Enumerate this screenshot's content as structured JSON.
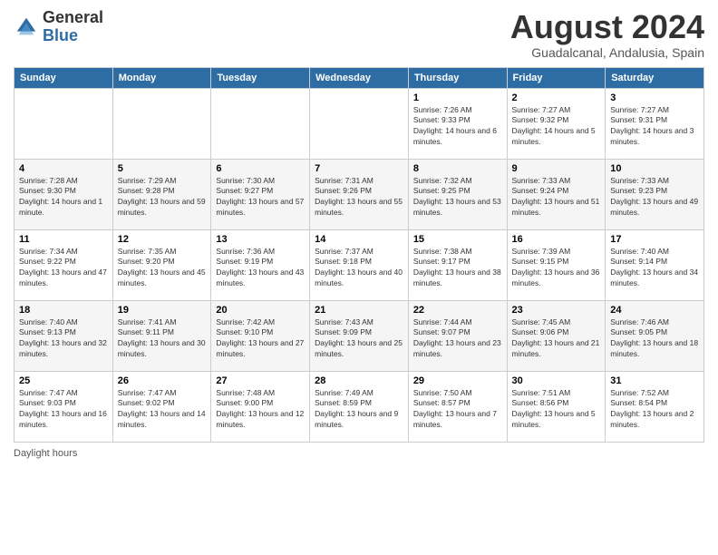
{
  "header": {
    "logo_general": "General",
    "logo_blue": "Blue",
    "main_title": "August 2024",
    "subtitle": "Guadalcanal, Andalusia, Spain"
  },
  "days_of_week": [
    "Sunday",
    "Monday",
    "Tuesday",
    "Wednesday",
    "Thursday",
    "Friday",
    "Saturday"
  ],
  "weeks": [
    [
      {
        "num": "",
        "sunrise": "",
        "sunset": "",
        "daylight": ""
      },
      {
        "num": "",
        "sunrise": "",
        "sunset": "",
        "daylight": ""
      },
      {
        "num": "",
        "sunrise": "",
        "sunset": "",
        "daylight": ""
      },
      {
        "num": "",
        "sunrise": "",
        "sunset": "",
        "daylight": ""
      },
      {
        "num": "1",
        "sunrise": "Sunrise: 7:26 AM",
        "sunset": "Sunset: 9:33 PM",
        "daylight": "Daylight: 14 hours and 6 minutes."
      },
      {
        "num": "2",
        "sunrise": "Sunrise: 7:27 AM",
        "sunset": "Sunset: 9:32 PM",
        "daylight": "Daylight: 14 hours and 5 minutes."
      },
      {
        "num": "3",
        "sunrise": "Sunrise: 7:27 AM",
        "sunset": "Sunset: 9:31 PM",
        "daylight": "Daylight: 14 hours and 3 minutes."
      }
    ],
    [
      {
        "num": "4",
        "sunrise": "Sunrise: 7:28 AM",
        "sunset": "Sunset: 9:30 PM",
        "daylight": "Daylight: 14 hours and 1 minute."
      },
      {
        "num": "5",
        "sunrise": "Sunrise: 7:29 AM",
        "sunset": "Sunset: 9:28 PM",
        "daylight": "Daylight: 13 hours and 59 minutes."
      },
      {
        "num": "6",
        "sunrise": "Sunrise: 7:30 AM",
        "sunset": "Sunset: 9:27 PM",
        "daylight": "Daylight: 13 hours and 57 minutes."
      },
      {
        "num": "7",
        "sunrise": "Sunrise: 7:31 AM",
        "sunset": "Sunset: 9:26 PM",
        "daylight": "Daylight: 13 hours and 55 minutes."
      },
      {
        "num": "8",
        "sunrise": "Sunrise: 7:32 AM",
        "sunset": "Sunset: 9:25 PM",
        "daylight": "Daylight: 13 hours and 53 minutes."
      },
      {
        "num": "9",
        "sunrise": "Sunrise: 7:33 AM",
        "sunset": "Sunset: 9:24 PM",
        "daylight": "Daylight: 13 hours and 51 minutes."
      },
      {
        "num": "10",
        "sunrise": "Sunrise: 7:33 AM",
        "sunset": "Sunset: 9:23 PM",
        "daylight": "Daylight: 13 hours and 49 minutes."
      }
    ],
    [
      {
        "num": "11",
        "sunrise": "Sunrise: 7:34 AM",
        "sunset": "Sunset: 9:22 PM",
        "daylight": "Daylight: 13 hours and 47 minutes."
      },
      {
        "num": "12",
        "sunrise": "Sunrise: 7:35 AM",
        "sunset": "Sunset: 9:20 PM",
        "daylight": "Daylight: 13 hours and 45 minutes."
      },
      {
        "num": "13",
        "sunrise": "Sunrise: 7:36 AM",
        "sunset": "Sunset: 9:19 PM",
        "daylight": "Daylight: 13 hours and 43 minutes."
      },
      {
        "num": "14",
        "sunrise": "Sunrise: 7:37 AM",
        "sunset": "Sunset: 9:18 PM",
        "daylight": "Daylight: 13 hours and 40 minutes."
      },
      {
        "num": "15",
        "sunrise": "Sunrise: 7:38 AM",
        "sunset": "Sunset: 9:17 PM",
        "daylight": "Daylight: 13 hours and 38 minutes."
      },
      {
        "num": "16",
        "sunrise": "Sunrise: 7:39 AM",
        "sunset": "Sunset: 9:15 PM",
        "daylight": "Daylight: 13 hours and 36 minutes."
      },
      {
        "num": "17",
        "sunrise": "Sunrise: 7:40 AM",
        "sunset": "Sunset: 9:14 PM",
        "daylight": "Daylight: 13 hours and 34 minutes."
      }
    ],
    [
      {
        "num": "18",
        "sunrise": "Sunrise: 7:40 AM",
        "sunset": "Sunset: 9:13 PM",
        "daylight": "Daylight: 13 hours and 32 minutes."
      },
      {
        "num": "19",
        "sunrise": "Sunrise: 7:41 AM",
        "sunset": "Sunset: 9:11 PM",
        "daylight": "Daylight: 13 hours and 30 minutes."
      },
      {
        "num": "20",
        "sunrise": "Sunrise: 7:42 AM",
        "sunset": "Sunset: 9:10 PM",
        "daylight": "Daylight: 13 hours and 27 minutes."
      },
      {
        "num": "21",
        "sunrise": "Sunrise: 7:43 AM",
        "sunset": "Sunset: 9:09 PM",
        "daylight": "Daylight: 13 hours and 25 minutes."
      },
      {
        "num": "22",
        "sunrise": "Sunrise: 7:44 AM",
        "sunset": "Sunset: 9:07 PM",
        "daylight": "Daylight: 13 hours and 23 minutes."
      },
      {
        "num": "23",
        "sunrise": "Sunrise: 7:45 AM",
        "sunset": "Sunset: 9:06 PM",
        "daylight": "Daylight: 13 hours and 21 minutes."
      },
      {
        "num": "24",
        "sunrise": "Sunrise: 7:46 AM",
        "sunset": "Sunset: 9:05 PM",
        "daylight": "Daylight: 13 hours and 18 minutes."
      }
    ],
    [
      {
        "num": "25",
        "sunrise": "Sunrise: 7:47 AM",
        "sunset": "Sunset: 9:03 PM",
        "daylight": "Daylight: 13 hours and 16 minutes."
      },
      {
        "num": "26",
        "sunrise": "Sunrise: 7:47 AM",
        "sunset": "Sunset: 9:02 PM",
        "daylight": "Daylight: 13 hours and 14 minutes."
      },
      {
        "num": "27",
        "sunrise": "Sunrise: 7:48 AM",
        "sunset": "Sunset: 9:00 PM",
        "daylight": "Daylight: 13 hours and 12 minutes."
      },
      {
        "num": "28",
        "sunrise": "Sunrise: 7:49 AM",
        "sunset": "Sunset: 8:59 PM",
        "daylight": "Daylight: 13 hours and 9 minutes."
      },
      {
        "num": "29",
        "sunrise": "Sunrise: 7:50 AM",
        "sunset": "Sunset: 8:57 PM",
        "daylight": "Daylight: 13 hours and 7 minutes."
      },
      {
        "num": "30",
        "sunrise": "Sunrise: 7:51 AM",
        "sunset": "Sunset: 8:56 PM",
        "daylight": "Daylight: 13 hours and 5 minutes."
      },
      {
        "num": "31",
        "sunrise": "Sunrise: 7:52 AM",
        "sunset": "Sunset: 8:54 PM",
        "daylight": "Daylight: 13 hours and 2 minutes."
      }
    ]
  ],
  "footer": {
    "daylight_label": "Daylight hours"
  }
}
